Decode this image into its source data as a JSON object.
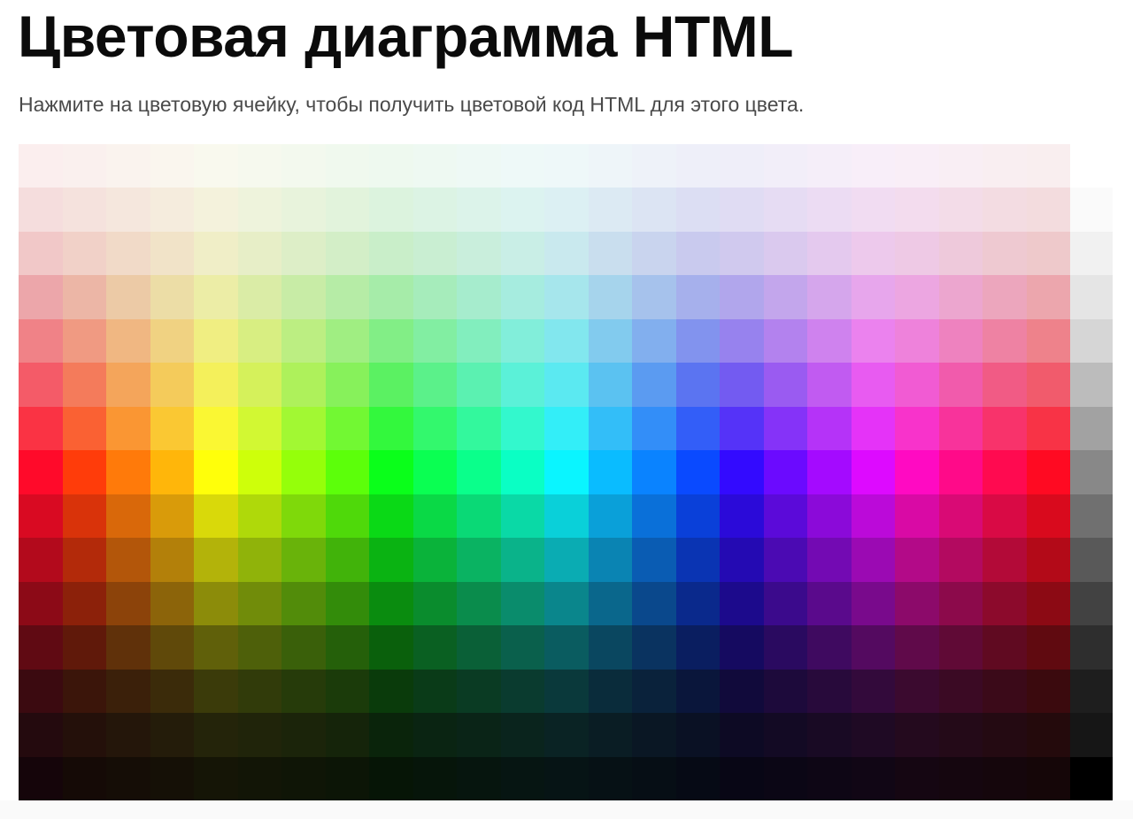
{
  "header": {
    "title": "Цветовая диаграмма HTML",
    "subtitle": "Нажмите на цветовую ячейку, чтобы получить цветовой код HTML для этого цвета."
  },
  "color_chart": {
    "rows": [
      [
        "#FBEEEE",
        "#FAF0EE",
        "#FAF3EE",
        "#FAF6EE",
        "#F9F9EE",
        "#F6F9EE",
        "#F3F9EE",
        "#F0F9EE",
        "#EEF9EF",
        "#EEF9F2",
        "#EEF9F5",
        "#EEF9F8",
        "#EEF8F9",
        "#EEF5F9",
        "#EEF2F9",
        "#EEEFF9",
        "#EFEEF9",
        "#F2EEF9",
        "#F5EEF9",
        "#F8EEF9",
        "#F9EEF7",
        "#F9EEF4",
        "#F9EEF1",
        "#F9EEEF",
        "#FFFFFF"
      ],
      [
        "#F5DDDD",
        "#F5E2DD",
        "#F5E7DD",
        "#F5ECDD",
        "#F4F2DC",
        "#EEF3DC",
        "#E8F3DC",
        "#E2F3DC",
        "#DCF3DE",
        "#DCF3E4",
        "#DCF3EA",
        "#DCF3F0",
        "#DCF0F3",
        "#DCEAF3",
        "#DCE4F3",
        "#DCDEF3",
        "#E0DCF3",
        "#E6DCF3",
        "#ECDCF3",
        "#F1DCF2",
        "#F3DCEE",
        "#F3DCE8",
        "#F3DCE2",
        "#F3DCDE",
        "#FAFAFA"
      ],
      [
        "#F1C8C8",
        "#F1D1C8",
        "#F1DAC8",
        "#F1E3C8",
        "#F0EEC7",
        "#E7EEC7",
        "#DDEEC7",
        "#D3EEC7",
        "#C9EEC9",
        "#C9EED2",
        "#C9EEDC",
        "#C9EEE6",
        "#C9E9EE",
        "#C9DEEE",
        "#C9D4EE",
        "#C9CAEE",
        "#D0C9EE",
        "#DAC9EE",
        "#E4C9EE",
        "#EDC9EC",
        "#EEC9E5",
        "#EEC9DB",
        "#EEC9D1",
        "#EEC9CB",
        "#F1F1F1"
      ],
      [
        "#ECA6AA",
        "#ECB6A6",
        "#ECCAA6",
        "#ECDDA6",
        "#ECEDA6",
        "#DAECA6",
        "#C8ECA6",
        "#B6ECA6",
        "#A6ECA9",
        "#A6ECBB",
        "#A6ECCD",
        "#A6ECDF",
        "#A6E6EC",
        "#A6D4EC",
        "#A6C2EC",
        "#A6B0EC",
        "#B1A6EC",
        "#C3A6EC",
        "#D5A6EC",
        "#E7A6EC",
        "#ECA6E1",
        "#ECA6CF",
        "#ECA6BD",
        "#ECA6AD",
        "#E5E5E5"
      ],
      [
        "#F08287",
        "#F09A82",
        "#F0B782",
        "#F0D282",
        "#F0EE82",
        "#D8EE82",
        "#BCEE82",
        "#A0EE82",
        "#82EE86",
        "#82EEA2",
        "#82EEBE",
        "#82EEDA",
        "#82E7EE",
        "#82CBEE",
        "#82AFEE",
        "#8293EE",
        "#9782EE",
        "#B382EE",
        "#CF82EE",
        "#EB82EE",
        "#EE82DB",
        "#EE82BF",
        "#EE82A3",
        "#EE828B",
        "#D6D6D6"
      ],
      [
        "#F45B68",
        "#F47B5B",
        "#F4A55B",
        "#F4CB5B",
        "#F4F05B",
        "#D5F15B",
        "#AEF15B",
        "#87F15B",
        "#5BF162",
        "#5BF18A",
        "#5BF1B1",
        "#5BF1D8",
        "#5BE9F1",
        "#5BC2F1",
        "#5B9BF1",
        "#5B74F1",
        "#735BF1",
        "#9A5BF1",
        "#C15BF1",
        "#E85BF1",
        "#F15BD3",
        "#F15BAC",
        "#F15B85",
        "#F15B6C",
        "#BCBCBC"
      ],
      [
        "#FA3344",
        "#FA6133",
        "#FA9633",
        "#FAC833",
        "#FAF733",
        "#D2F833",
        "#A2F833",
        "#72F833",
        "#33F83D",
        "#33F86D",
        "#33F89D",
        "#33F8CD",
        "#33EEF8",
        "#33BEF8",
        "#338EF8",
        "#335EF8",
        "#5533F8",
        "#8533F8",
        "#B533F8",
        "#E533F8",
        "#F833CB",
        "#F8339B",
        "#F8336B",
        "#F83346",
        "#A2A2A2"
      ],
      [
        "#FF0A2A",
        "#FF3C0A",
        "#FF7A0A",
        "#FFB60A",
        "#FFFF0A",
        "#CEFF0A",
        "#95FF0A",
        "#5CFF0A",
        "#0AFF1A",
        "#0AFF52",
        "#0AFF8B",
        "#0AFFC4",
        "#0AF5FF",
        "#0ABCFF",
        "#0A83FF",
        "#0A4AFF",
        "#330AFF",
        "#6B0AFF",
        "#A40AFF",
        "#DD0AFF",
        "#FF0AC2",
        "#FF0A89",
        "#FF0A50",
        "#FF0A22",
        "#888888"
      ],
      [
        "#D90A22",
        "#D9330A",
        "#D9680A",
        "#D99B0A",
        "#D9D90A",
        "#AFD90A",
        "#7FD90A",
        "#4FD90A",
        "#0AD916",
        "#0AD946",
        "#0AD976",
        "#0AD9A6",
        "#0AD0D9",
        "#0AA0D9",
        "#0A70D9",
        "#0A40D9",
        "#2B0AD9",
        "#5B0AD9",
        "#8B0AD9",
        "#BB0AD9",
        "#D90AA5",
        "#D90A75",
        "#D90A45",
        "#D90A1D",
        "#707070"
      ],
      [
        "#B30A1C",
        "#B32A0A",
        "#B3560A",
        "#B3800A",
        "#B3B30A",
        "#90B30A",
        "#69B30A",
        "#41B30A",
        "#0AB312",
        "#0AB33A",
        "#0AB362",
        "#0AB38A",
        "#0AACB3",
        "#0A84B3",
        "#0A5CB3",
        "#0A34B3",
        "#240AB3",
        "#4B0AB3",
        "#730AB3",
        "#9B0AB3",
        "#B30A88",
        "#B30A60",
        "#B30A38",
        "#B30A18",
        "#595959"
      ],
      [
        "#8C0A17",
        "#8C210A",
        "#8C430A",
        "#8C640A",
        "#8C8C0A",
        "#718C0A",
        "#528C0A",
        "#338C0A",
        "#0A8C0F",
        "#0A8C2D",
        "#0A8C4C",
        "#0A8C6C",
        "#0A868C",
        "#0A678C",
        "#0A488C",
        "#0A298C",
        "#1C0A8C",
        "#3B0A8C",
        "#5A0A8C",
        "#790A8C",
        "#8C0A6A",
        "#8C0A4B",
        "#8C0A2C",
        "#8C0A14",
        "#424242"
      ],
      [
        "#600A13",
        "#60190A",
        "#60310A",
        "#60490A",
        "#60600A",
        "#4E600A",
        "#3A600A",
        "#25600A",
        "#0A600C",
        "#0A6022",
        "#0A6037",
        "#0A604C",
        "#0A5C60",
        "#0A4760",
        "#0A3360",
        "#0A1E60",
        "#150A60",
        "#2A0A60",
        "#3F0A60",
        "#540A60",
        "#600A4A",
        "#600A36",
        "#600A21",
        "#600A10",
        "#2E2E2E"
      ],
      [
        "#3B0A10",
        "#3B150A",
        "#3B200A",
        "#3B2B0A",
        "#3B3B0A",
        "#313B0A",
        "#263B0A",
        "#1B3B0A",
        "#0A3B0B",
        "#0A3B18",
        "#0A3B23",
        "#0A3B2F",
        "#0A393B",
        "#0A2C3B",
        "#0A223B",
        "#0A163B",
        "#110A3B",
        "#1D0A3B",
        "#280A3B",
        "#330A3B",
        "#3B0A2F",
        "#3B0A24",
        "#3B0A19",
        "#3B0A0E",
        "#1E1E1E"
      ],
      [
        "#240A0E",
        "#24100A",
        "#24160A",
        "#241C0A",
        "#24240A",
        "#20240A",
        "#1B240A",
        "#15240A",
        "#0A240B",
        "#0A2412",
        "#0A2417",
        "#0A241D",
        "#0A2324",
        "#0A1D24",
        "#0A1724",
        "#0A1124",
        "#0D0A24",
        "#130A24",
        "#190A24",
        "#1F0A24",
        "#240A1E",
        "#240A18",
        "#240A12",
        "#240A0C",
        "#161616"
      ],
      [
        "#15050A",
        "#150A06",
        "#150D06",
        "#151006",
        "#151506",
        "#121506",
        "#0F1506",
        "#0C1506",
        "#061506",
        "#06150A",
        "#06150E",
        "#061512",
        "#061415",
        "#061115",
        "#060E15",
        "#060A15",
        "#080615",
        "#0B0615",
        "#0E0615",
        "#110615",
        "#150612",
        "#15060F",
        "#15060C",
        "#150608",
        "#000000"
      ]
    ]
  }
}
